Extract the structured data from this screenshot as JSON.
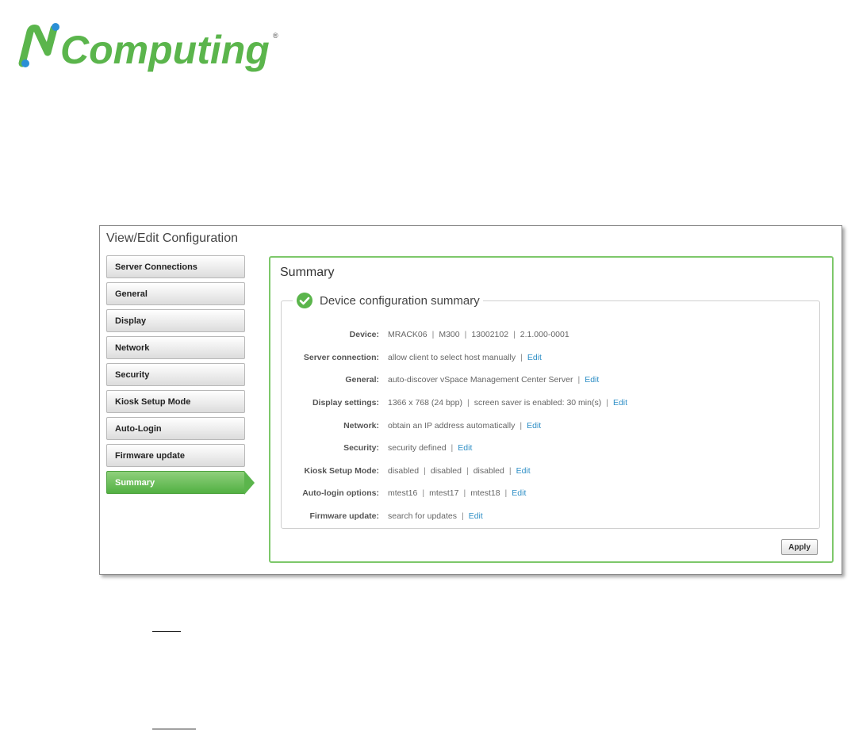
{
  "logo": {
    "text_n": "N",
    "text_rest": "Computing",
    "registered": "®"
  },
  "window": {
    "title": "View/Edit Configuration"
  },
  "sidebar": {
    "items": [
      {
        "label": "Server Connections",
        "active": false
      },
      {
        "label": "General",
        "active": false
      },
      {
        "label": "Display",
        "active": false
      },
      {
        "label": "Network",
        "active": false
      },
      {
        "label": "Security",
        "active": false
      },
      {
        "label": "Kiosk Setup Mode",
        "active": false
      },
      {
        "label": "Auto-Login",
        "active": false
      },
      {
        "label": "Firmware update",
        "active": false
      },
      {
        "label": "Summary",
        "active": true
      }
    ]
  },
  "panel": {
    "title": "Summary",
    "section_title": "Device configuration summary",
    "rows": [
      {
        "label": "Device:",
        "values": [
          "MRACK06",
          "M300",
          "13002102",
          "2.1.000-0001"
        ],
        "edit": ""
      },
      {
        "label": "Server connection:",
        "values": [
          "allow client to select host manually"
        ],
        "edit": "Edit"
      },
      {
        "label": "General:",
        "values": [
          "auto-discover vSpace Management Center Server"
        ],
        "edit": "Edit"
      },
      {
        "label": "Display settings:",
        "values": [
          "1366 x 768 (24 bpp)",
          "screen saver is enabled: 30 min(s)"
        ],
        "edit": "Edit"
      },
      {
        "label": "Network:",
        "values": [
          "obtain an IP address automatically"
        ],
        "edit": "Edit"
      },
      {
        "label": "Security:",
        "values": [
          "security defined"
        ],
        "edit": "Edit"
      },
      {
        "label": "Kiosk Setup Mode:",
        "values": [
          "disabled",
          "disabled",
          "disabled"
        ],
        "edit": "Edit"
      },
      {
        "label": "Auto-login options:",
        "values": [
          "mtest16",
          "mtest17",
          "mtest18"
        ],
        "edit": "Edit"
      },
      {
        "label": "Firmware update:",
        "values": [
          "search for updates"
        ],
        "edit": "Edit"
      }
    ],
    "apply_label": "Apply"
  },
  "colors": {
    "brand_green": "#5bb54c",
    "brand_blue": "#2b8fd6",
    "link": "#2f8fc6"
  },
  "icons": {
    "section": "check-circle-icon"
  }
}
